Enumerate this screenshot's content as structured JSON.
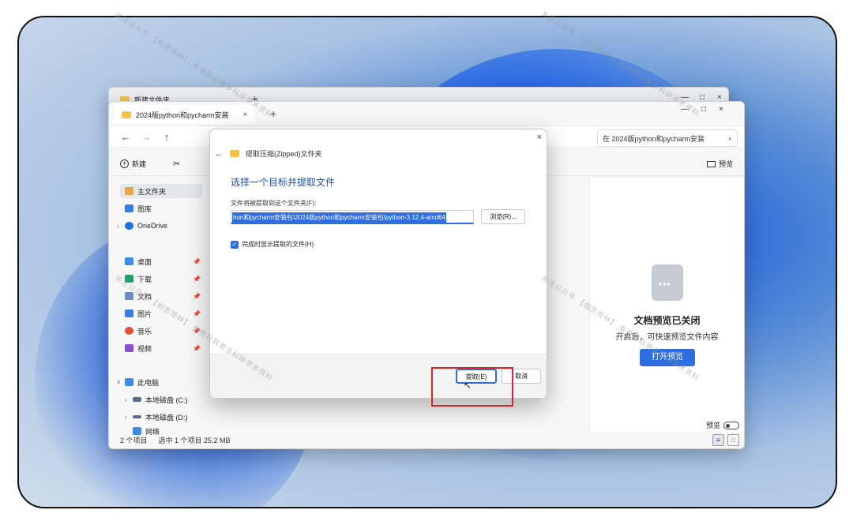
{
  "back_window": {
    "tab_title": "新建文件夹",
    "close_glyph": "×",
    "new_tab_glyph": "+",
    "min_glyph": "—",
    "max_glyph": "□",
    "close_window_glyph": "×"
  },
  "main_window": {
    "tab_title": "2024版python和pycharm安装",
    "tab_close_glyph": "×",
    "new_tab_glyph": "+",
    "nav": {
      "back": "←",
      "forward": "→",
      "up": "↑"
    },
    "search_placeholder": "在 2024版python和pycharm安装",
    "search_icon": "⌕",
    "new_button_label": "新建",
    "cut_icon": "✂",
    "details_label": "预览",
    "sidebar": {
      "home": "主文件夹",
      "gallery": "图库",
      "onedrive": "OneDrive",
      "desktop": "桌面",
      "downloads": "下载",
      "documents": "文档",
      "pictures": "图片",
      "music": "音乐",
      "videos": "视频",
      "this_pc": "此电脑",
      "drive_c": "本地磁盘 (C:)",
      "drive_d": "本地磁盘 (D:)",
      "network": "网络"
    },
    "preview_pane": {
      "title": "文档预览已关闭",
      "subtitle": "开启后，可快速预览文件内容",
      "button": "打开预览"
    },
    "status": {
      "items": "2 个项目",
      "selected": "选中 1 个项目  25.2 MB",
      "toggle_label": "预览"
    }
  },
  "dialog": {
    "header": "提取压缩(Zipped)文件夹",
    "heading": "选择一个目标并提取文件",
    "path_label": "文件将被提取到这个文件夹(F):",
    "path_value": "hon和pycharm安装包\\2024版python和pycharm安装包\\python-3.12.4-amd64",
    "browse_label": "浏览(R)...",
    "checkbox_label": "完成时显示提取的文件(H)",
    "checkbox_checked": true,
    "extract_label": "提取(E)",
    "cancel_label": "取消",
    "close_glyph": "×"
  },
  "colors": {
    "accent": "#2c6ee0",
    "highlight_box": "#d42828",
    "folder": "#f0c44c"
  }
}
